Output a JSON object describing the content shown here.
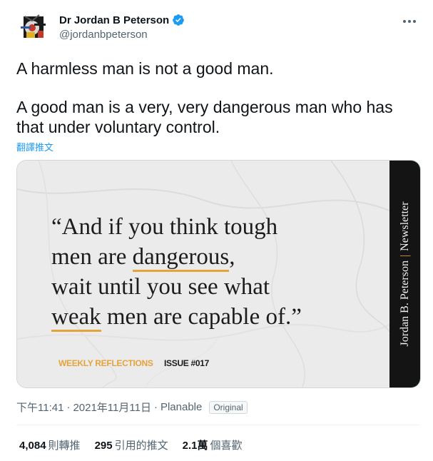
{
  "author": {
    "display_name": "Dr Jordan B Peterson",
    "handle": "@jordanbpeterson",
    "verified_icon": "verified-badge-icon",
    "avatar_icon": "avatar-logo"
  },
  "tweet": {
    "paragraphs": [
      "A harmless man is not a good man.",
      "A good man is a very, very dangerous man who has that under voluntary control."
    ],
    "translate_label": "翻譯推文"
  },
  "media": {
    "quote_lines": [
      "“And if you think tough",
      "men are dangerous,",
      "wait until you see what",
      "weak men are capable of.”"
    ],
    "underlined_words": [
      "dangerous",
      "weak"
    ],
    "footer_left": "WEEKLY REFLECTIONS",
    "footer_right": "ISSUE #017",
    "side_title": "Jordan B. Peterson",
    "side_separator": "|",
    "side_subtitle": "Newsletter",
    "accent_color": "#e6a33b"
  },
  "meta": {
    "time": "下午11:41",
    "sep1": "·",
    "date": "2021年11月11日",
    "sep2": "·",
    "source": "Planable",
    "badge": "Original"
  },
  "stats": {
    "retweets": {
      "value": "4,084",
      "label": "則轉推"
    },
    "quotes": {
      "value": "295",
      "label": "引用的推文"
    },
    "likes": {
      "value": "2.1萬",
      "label": "個喜歡"
    }
  }
}
